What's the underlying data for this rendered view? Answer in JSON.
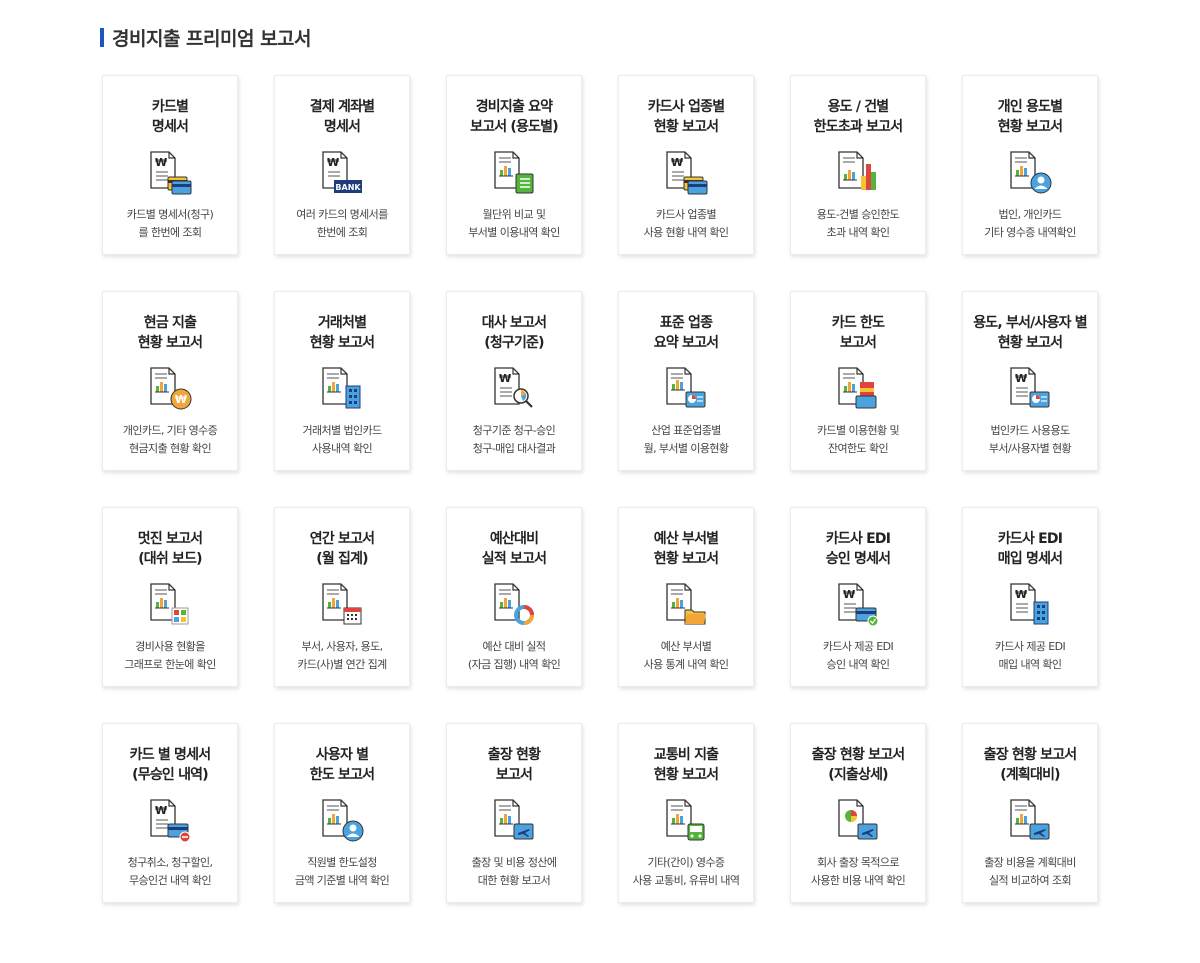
{
  "header": {
    "title": "경비지출 프리미엄 보고서"
  },
  "colors": {
    "accent": "#1a56c4",
    "navy": "#1f3d7a",
    "green": "#55b53a",
    "orange": "#f3a53a",
    "blue": "#4aa3df",
    "red": "#e0443d",
    "yellow": "#f5c333"
  },
  "cards": [
    {
      "title": "카드별\n명세서",
      "icon": "won-document-card-icon",
      "desc": "카드별 명세서(청구)\n를 한번에 조회"
    },
    {
      "title": "결제 계좌별\n명세서",
      "icon": "won-document-bank-icon",
      "badge": "BANK",
      "desc": "여러 카드의 명세서를\n한번에 조회"
    },
    {
      "title": "경비지출 요약\n보고서 (용도별)",
      "icon": "chart-document-list-icon",
      "desc": "월단위 비교 및\n부서별 이용내역 확인"
    },
    {
      "title": "카드사 업종별\n현황 보고서",
      "icon": "won-document-card-icon",
      "desc": "카드사 업종별\n사용 현황 내역 확인"
    },
    {
      "title": "용도 / 건별\n한도초과 보고서",
      "icon": "chart-document-bars-icon",
      "desc": "용도-건별 승인한도\n초과 내역 확인"
    },
    {
      "title": "개인 용도별\n현황 보고서",
      "icon": "chart-document-user-icon",
      "desc": "법인, 개인카드\n기타 영수증 내역확인"
    },
    {
      "title": "현금 지출\n현황 보고서",
      "icon": "chart-document-coin-icon",
      "desc": "개인카드, 기타 영수증\n현금지출 현황 확인"
    },
    {
      "title": "거래처별\n현황 보고서",
      "icon": "chart-document-building-icon",
      "desc": "거래처별 법인카드\n사용내역 확인"
    },
    {
      "title": "대사 보고서\n(청구기준)",
      "icon": "won-document-magnifier-icon",
      "desc": "청구기준 청구-승인\n청구-매입 대사결과"
    },
    {
      "title": "표준 업종\n요약 보고서",
      "icon": "chart-document-piechart-icon",
      "desc": "산업 표준업종별\n월, 부서별 이용현황"
    },
    {
      "title": "카드 한도\n보고서",
      "icon": "chart-document-card-icon",
      "desc": "카드별 이용현황 및\n잔여한도 확인"
    },
    {
      "title": "용도, 부서/사용자 별\n현황 보고서",
      "icon": "won-document-piechart-icon",
      "desc": "법인카드 사용용도\n부서/사용자별 현황",
      "smallFirst": true
    },
    {
      "title": "멋진 보고서\n(대쉬 보드)",
      "icon": "chart-document-dashboard-icon",
      "desc": "경비사용 현황을\n그래프로 한눈에 확인"
    },
    {
      "title": "연간 보고서\n(월 집계)",
      "icon": "chart-document-calendar-icon",
      "desc": "부서, 사용자, 용도,\n카드(사)별 연간 집계"
    },
    {
      "title": "예산대비\n실적 보고서",
      "icon": "chart-document-donut-icon",
      "desc": "예산 대비 실적\n(자금 집행) 내역 확인"
    },
    {
      "title": "예산 부서별\n현황 보고서",
      "icon": "chart-document-folder-icon",
      "desc": "예산 부서별\n사용 통계 내역 확인"
    },
    {
      "title": "카드사 EDI\n승인 명세서",
      "icon": "won-document-card-check-icon",
      "desc": "카드사 제공 EDI\n승인 내역 확인"
    },
    {
      "title": "카드사 EDI\n매입 명세서",
      "icon": "won-document-building-icon",
      "desc": "카드사 제공 EDI\n매입 내역 확인"
    },
    {
      "title": "카드 별 명세서\n(무승인 내역)",
      "icon": "won-document-card-minus-icon",
      "desc": "청구취소, 청구할인,\n무승인건 내역 확인"
    },
    {
      "title": "사용자 별\n한도 보고서",
      "icon": "chart-document-user-icon",
      "desc": "직원별 한도설정\n금액 기준별 내역 확인"
    },
    {
      "title": "출장 현황\n보고서",
      "icon": "chart-document-plane-icon",
      "desc": "출장 및  비용 정산에\n대한 현황 보고서"
    },
    {
      "title": "교통비 지출\n현황 보고서",
      "icon": "chart-document-bus-icon",
      "desc": "기타(간이) 영수증\n사용 교통비, 유류비 내역"
    },
    {
      "title": "출장 현황 보고서\n(지출상세)",
      "icon": "pie-document-plane-icon",
      "desc": "회사 출장 목적으로\n사용한 비용 내역 확인"
    },
    {
      "title": "출장 현황 보고서\n(계획대비)",
      "icon": "chart-document-plane-icon",
      "desc": "출장 비용을 계획대비\n실적 비교하여 조회"
    }
  ]
}
